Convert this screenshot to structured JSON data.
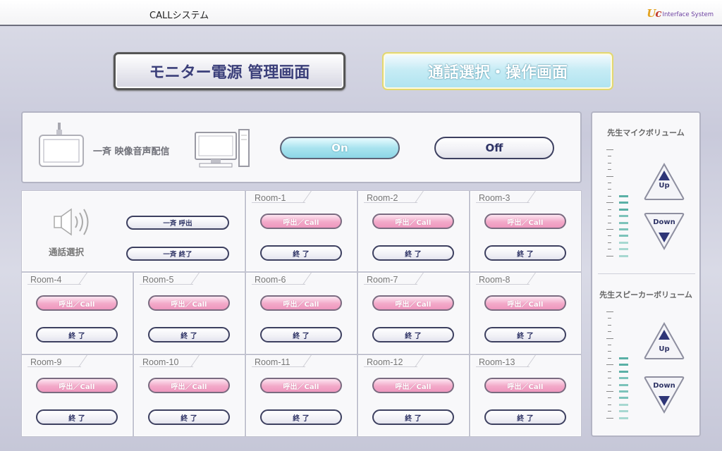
{
  "header": {
    "app_title": "CALLシステム",
    "logo_mark": "Uc",
    "logo_text": "Interface System"
  },
  "nav": {
    "monitor_label": "モニター電源 管理画面",
    "call_label": "通話選択・操作画面",
    "active": "call"
  },
  "broadcast": {
    "label": "一斉 映像音声配信",
    "on_label": "On",
    "off_label": "Off",
    "state": "On"
  },
  "call_select": {
    "label": "通話選択",
    "all_call_label": "一斉 呼出",
    "all_end_label": "一斉 終了"
  },
  "rooms": [
    {
      "name": "Room-1",
      "call": "呼出／Call",
      "end": "終 了"
    },
    {
      "name": "Room-2",
      "call": "呼出／Call",
      "end": "終 了"
    },
    {
      "name": "Room-3",
      "call": "呼出／Call",
      "end": "終 了"
    },
    {
      "name": "Room-4",
      "call": "呼出／Call",
      "end": "終 了"
    },
    {
      "name": "Room-5",
      "call": "呼出／Call",
      "end": "終 了"
    },
    {
      "name": "Room-6",
      "call": "呼出／Call",
      "end": "終 了"
    },
    {
      "name": "Room-7",
      "call": "呼出／Call",
      "end": "終 了"
    },
    {
      "name": "Room-8",
      "call": "呼出／Call",
      "end": "終 了"
    },
    {
      "name": "Room-9",
      "call": "呼出／Call",
      "end": "終 了"
    },
    {
      "name": "Room-10",
      "call": "呼出／Call",
      "end": "終 了"
    },
    {
      "name": "Room-11",
      "call": "呼出／Call",
      "end": "終 了"
    },
    {
      "name": "Room-12",
      "call": "呼出／Call",
      "end": "終 了"
    },
    {
      "name": "Room-13",
      "call": "呼出／Call",
      "end": "終 了"
    }
  ],
  "volume": {
    "mic": {
      "title": "先生マイクボリューム",
      "up": "Up",
      "down": "Down",
      "level": 0.5
    },
    "speaker": {
      "title": "先生スピーカーボリューム",
      "up": "Up",
      "down": "Down",
      "level": 0.5
    }
  },
  "colors": {
    "accent_teal": "#8cd6e6",
    "call_pink": "#f3a9c9",
    "text_navy": "#2f3466",
    "meter_teal": "#4aa99f"
  },
  "icons": {
    "tablet": "tablet-icon",
    "pc": "desktop-pc-icon",
    "speaker": "speaker-icon",
    "up": "triangle-up-icon",
    "down": "triangle-down-icon"
  }
}
